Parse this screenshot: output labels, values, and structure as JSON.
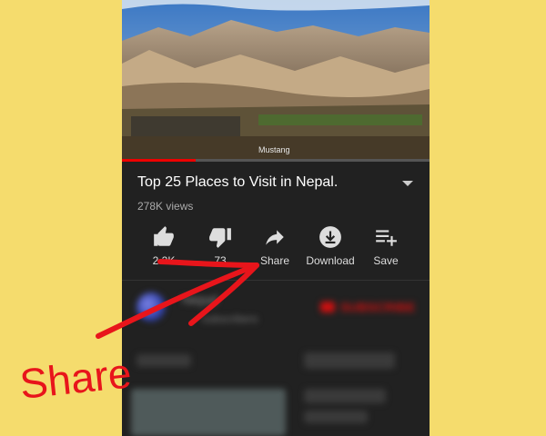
{
  "video": {
    "caption": "Mustang",
    "progress_fraction": 0.24,
    "title": "Top 25 Places to Visit in Nepal.",
    "views": "278K views"
  },
  "actions": [
    {
      "name": "like",
      "label": "2.2K",
      "icon": "thumbs-up-icon"
    },
    {
      "name": "dislike",
      "label": "73",
      "icon": "thumbs-down-icon"
    },
    {
      "name": "share",
      "label": "Share",
      "icon": "share-arrow-icon"
    },
    {
      "name": "download",
      "label": "Download",
      "icon": "download-icon"
    },
    {
      "name": "save",
      "label": "Save",
      "icon": "playlist-add-icon"
    }
  ],
  "channel": {
    "name": "Nepal",
    "subscribers": "subscribers",
    "subscribe_label": "SUBSCRIBE"
  },
  "annotation": {
    "text": "Share",
    "color": "#e8151b"
  },
  "colors": {
    "background": "#f5dc6d",
    "app_bg": "#212121",
    "accent_red": "#cc1010"
  }
}
